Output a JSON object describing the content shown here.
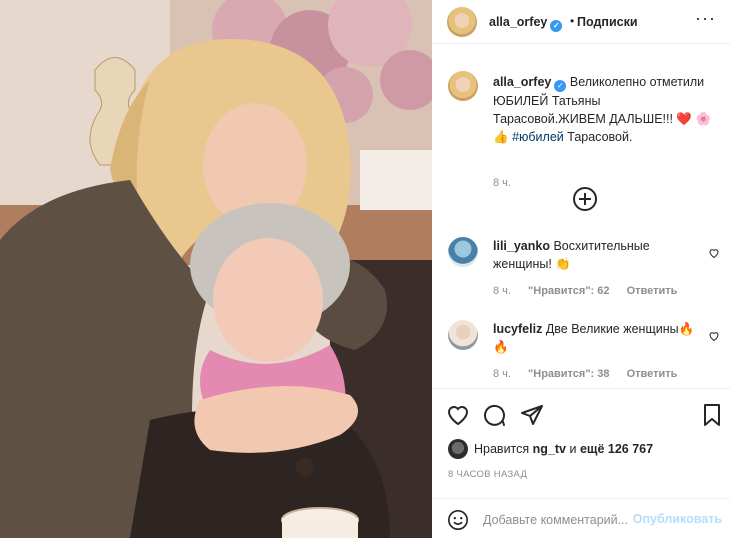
{
  "post": {
    "author": "alla_orfey",
    "follow_label": "Подписки",
    "dot": "•",
    "more": "···"
  },
  "caption": {
    "author": "alla_orfey",
    "text": "Великолепно отметили ЮБИЛЕЙ Татьяны Тарасовой.ЖИВЕМ ДАЛЬШЕ!!! ❤️ 🌸 👍",
    "hashtag": "#юбилей",
    "tail": "Тарасовой.",
    "time": "8 ч."
  },
  "comments": [
    {
      "author": "lili_yanko",
      "text": "Восхитительные женщины! 👏",
      "time": "8 ч.",
      "likes": "\"Нравится\": 62",
      "reply": "Ответить"
    },
    {
      "author": "lucyfeliz",
      "text": "Две Великие женщины🔥 🔥",
      "time": "8 ч.",
      "likes": "\"Нравится\": 38",
      "reply": "Ответить"
    }
  ],
  "likes": {
    "prefix": "Нравится",
    "user": "ng_tv",
    "middle": "и",
    "count": "ещё 126 767"
  },
  "date": "8 ЧАСОВ НАЗАД",
  "add_comment": {
    "placeholder": "Добавьте комментарий...",
    "publish": "Опубликовать"
  },
  "colors": {
    "link": "#00376b",
    "verified": "#3897f0",
    "publish_disabled": "#b2dffc",
    "muted": "#8e8e8e"
  },
  "icons": [
    "verified-icon",
    "more-icon",
    "load-more-icon",
    "heart-icon",
    "comment-icon",
    "share-icon",
    "bookmark-icon",
    "emoji-icon"
  ]
}
